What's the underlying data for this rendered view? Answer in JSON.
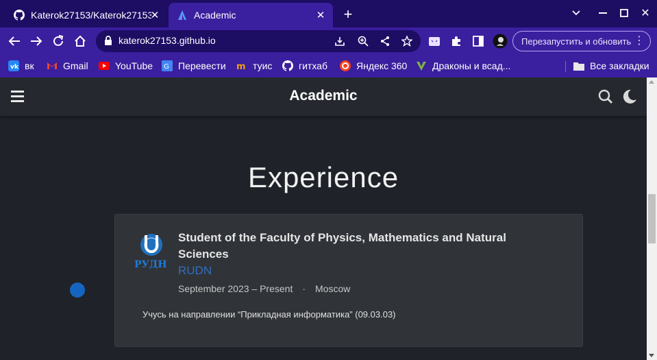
{
  "browser": {
    "tabs": [
      {
        "title": "Katerok27153/Katerok27153",
        "icon": "github-icon",
        "active": false
      },
      {
        "title": "Academic",
        "icon": "academic-icon",
        "active": true
      }
    ],
    "url": "katerok27153.github.io",
    "relaunch_label": "Перезапустить и обновить",
    "bookmarks": [
      {
        "label": "вк",
        "icon": "vk-icon"
      },
      {
        "label": "Gmail",
        "icon": "gmail-icon"
      },
      {
        "label": "YouTube",
        "icon": "youtube-icon"
      },
      {
        "label": "Перевести",
        "icon": "translate-icon"
      },
      {
        "label": "туис",
        "icon": "tuis-icon"
      },
      {
        "label": "гитхаб",
        "icon": "github-icon"
      },
      {
        "label": "Яндекс 360",
        "icon": "yandex360-icon"
      },
      {
        "label": "Драконы и всад...",
        "icon": "dragons-icon"
      }
    ],
    "all_bookmarks_label": "Все закладки"
  },
  "site": {
    "brand": "Academic",
    "section_title": "Experience",
    "experience": {
      "role": "Student of the Faculty of Physics, Mathematics and Natural Sciences",
      "org": "RUDN",
      "logo_text": "РУДН",
      "dates": "September 2023 – Present",
      "separator": "·",
      "location": "Moscow",
      "description": "Учусь на направлении “Прикладная информатика” (09.03.03)"
    }
  },
  "colors": {
    "tabstrip": "#1d0d63",
    "toolbar": "#3a1f9e",
    "site_bg": "#1f2229",
    "card_bg": "#303338",
    "accent": "#2f6fc0",
    "timeline_dot": "#1565c0"
  }
}
